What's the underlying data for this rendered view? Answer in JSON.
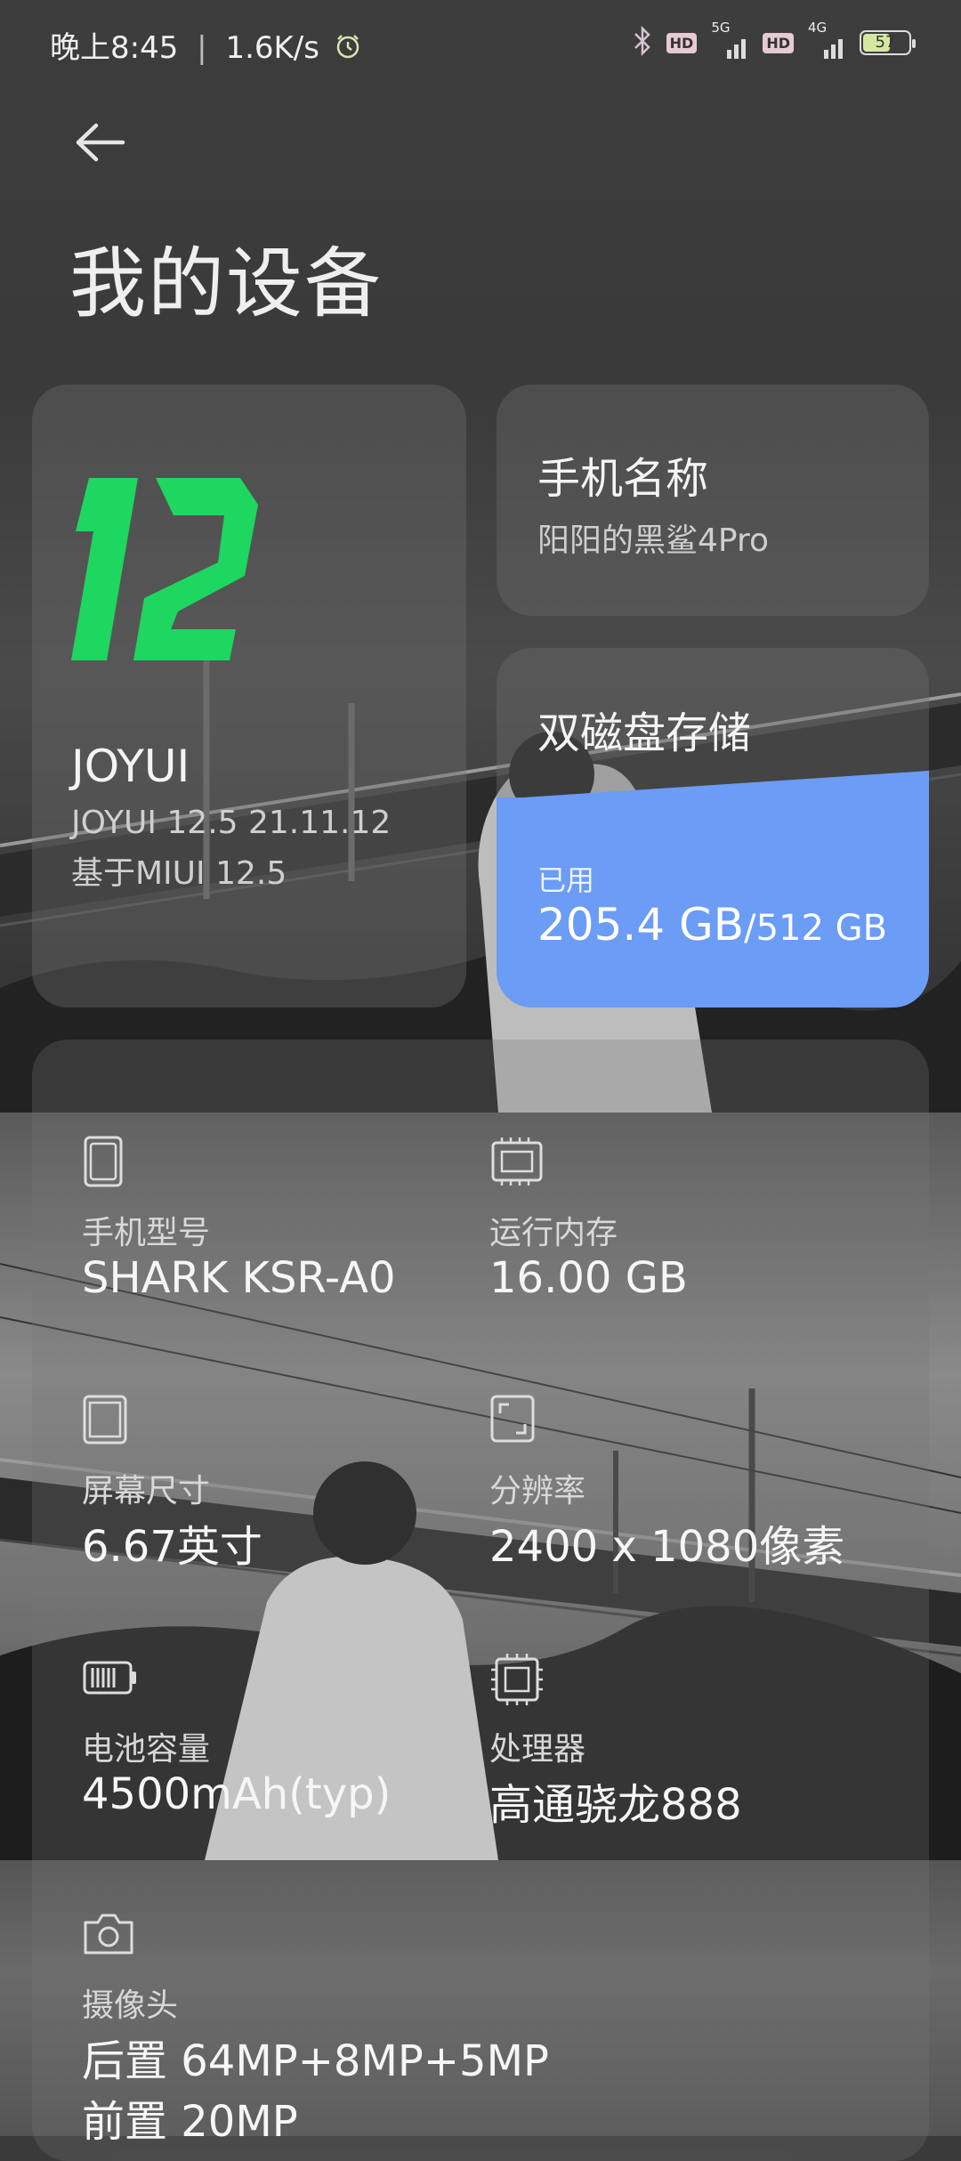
{
  "status_bar": {
    "time": "晚上8:45",
    "speed": "1.6K/s",
    "network1": "5G",
    "network2": "4G",
    "hd_label": "HD",
    "battery": "57"
  },
  "header": {
    "title": "我的设备"
  },
  "os_card": {
    "logo_text": "12",
    "name": "JOYUI",
    "version": "JOYUI 12.5 21.11.12",
    "base": "基于MIUI 12.5"
  },
  "device_name_card": {
    "label": "手机名称",
    "value": "阳阳的黑鲨4Pro"
  },
  "storage_card": {
    "label": "双磁盘存储",
    "used_label": "已用",
    "used": "205.4 GB",
    "total": "/512 GB",
    "used_fraction": 0.401
  },
  "specs": [
    {
      "icon": "phone-icon",
      "label": "手机型号",
      "value": "SHARK KSR-A0"
    },
    {
      "icon": "memory-chip-icon",
      "label": "运行内存",
      "value": "16.00 GB"
    },
    {
      "icon": "screen-icon",
      "label": "屏幕尺寸",
      "value": "6.67英寸"
    },
    {
      "icon": "resolution-icon",
      "label": "分辨率",
      "value": "2400 x 1080像素"
    },
    {
      "icon": "battery-icon",
      "label": "电池容量",
      "value": "4500mAh(typ)"
    },
    {
      "icon": "processor-icon",
      "label": "处理器",
      "value": "高通骁龙888"
    },
    {
      "icon": "camera-icon",
      "label": "摄像头",
      "value": "后置 64MP+8MP+5MP",
      "value2": "前置 20MP"
    }
  ],
  "colors": {
    "storage_fill": "#6b9cf6",
    "logo_green": "#1ed760"
  }
}
